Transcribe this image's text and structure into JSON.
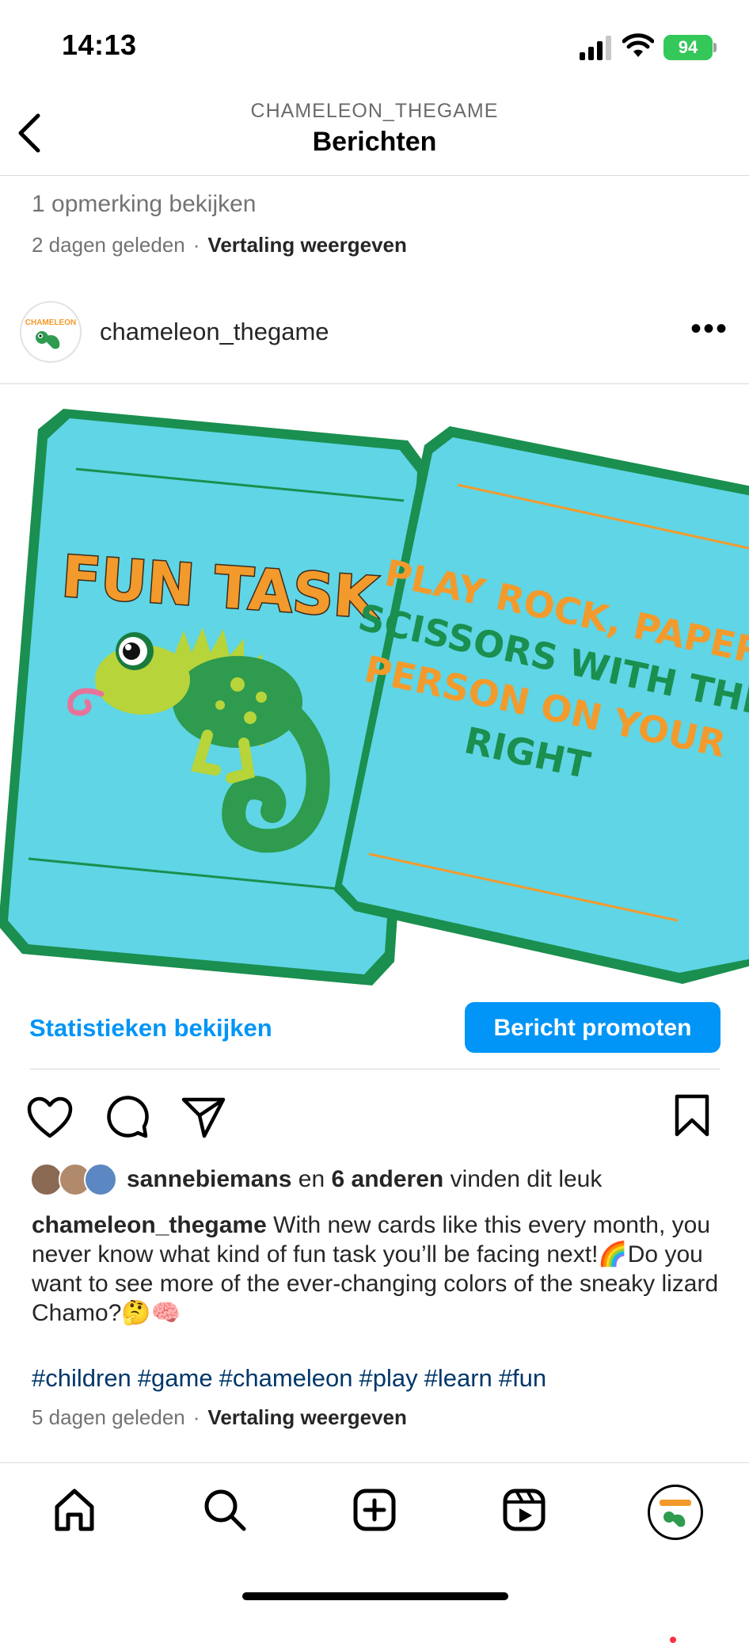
{
  "status_bar": {
    "time": "14:13",
    "battery": "94"
  },
  "header": {
    "account": "CHAMELEON_THEGAME",
    "title": "Berichten"
  },
  "previous_post": {
    "view_comments": "1 opmerking bekijken",
    "time_ago": "2 dagen geleden",
    "separator": "·",
    "translate": "Vertaling weergeven"
  },
  "post": {
    "username": "chameleon_thegame",
    "avatar_logo_text": "CHAMELEON",
    "image": {
      "card1_title": "FUN TASK",
      "card2_lines": [
        "PLAY ROCK, PAPER,",
        "SCISSORS WITH THE",
        "PERSON ON YOUR",
        "RIGHT"
      ]
    },
    "stats_link": "Statistieken bekijken",
    "promote_button": "Bericht promoten",
    "likes": {
      "user": "sannebiemans",
      "and": "en",
      "others": "6 anderen",
      "suffix": "vinden dit leuk"
    },
    "caption": {
      "user": "chameleon_thegame",
      "text": "With new cards like this every month, you never know what kind of fun task you’ll be facing next!🌈Do you want to see more of the ever-changing colors of the sneaky lizard Chamo?🤔🧠"
    },
    "hashtags": [
      "#children",
      "#game",
      "#chameleon",
      "#play",
      "#learn",
      "#fun"
    ],
    "time_ago": "5 dagen geleden",
    "separator": "·",
    "translate": "Vertaling weergeven"
  },
  "colors": {
    "accent": "#0095f6",
    "card_blue": "#5fd5e5",
    "card_green": "#1a8f4f",
    "title_orange": "#f39a2c",
    "battery_green": "#34c759"
  },
  "icons": {
    "back": "chevron-left-icon",
    "more": "more-horizontal-icon",
    "like": "heart-icon",
    "comment": "comment-icon",
    "share": "send-icon",
    "save": "bookmark-icon",
    "home": "home-icon",
    "search": "search-icon",
    "create": "plus-square-icon",
    "reels": "reels-icon",
    "profile": "profile-avatar"
  }
}
